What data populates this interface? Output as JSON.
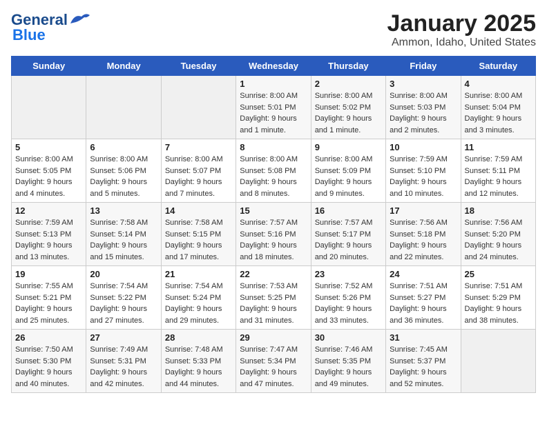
{
  "logo": {
    "line1": "General",
    "line2": "Blue"
  },
  "title": "January 2025",
  "subtitle": "Ammon, Idaho, United States",
  "days_of_week": [
    "Sunday",
    "Monday",
    "Tuesday",
    "Wednesday",
    "Thursday",
    "Friday",
    "Saturday"
  ],
  "weeks": [
    [
      {
        "day": "",
        "info": ""
      },
      {
        "day": "",
        "info": ""
      },
      {
        "day": "",
        "info": ""
      },
      {
        "day": "1",
        "info": "Sunrise: 8:00 AM\nSunset: 5:01 PM\nDaylight: 9 hours\nand 1 minute."
      },
      {
        "day": "2",
        "info": "Sunrise: 8:00 AM\nSunset: 5:02 PM\nDaylight: 9 hours\nand 1 minute."
      },
      {
        "day": "3",
        "info": "Sunrise: 8:00 AM\nSunset: 5:03 PM\nDaylight: 9 hours\nand 2 minutes."
      },
      {
        "day": "4",
        "info": "Sunrise: 8:00 AM\nSunset: 5:04 PM\nDaylight: 9 hours\nand 3 minutes."
      }
    ],
    [
      {
        "day": "5",
        "info": "Sunrise: 8:00 AM\nSunset: 5:05 PM\nDaylight: 9 hours\nand 4 minutes."
      },
      {
        "day": "6",
        "info": "Sunrise: 8:00 AM\nSunset: 5:06 PM\nDaylight: 9 hours\nand 5 minutes."
      },
      {
        "day": "7",
        "info": "Sunrise: 8:00 AM\nSunset: 5:07 PM\nDaylight: 9 hours\nand 7 minutes."
      },
      {
        "day": "8",
        "info": "Sunrise: 8:00 AM\nSunset: 5:08 PM\nDaylight: 9 hours\nand 8 minutes."
      },
      {
        "day": "9",
        "info": "Sunrise: 8:00 AM\nSunset: 5:09 PM\nDaylight: 9 hours\nand 9 minutes."
      },
      {
        "day": "10",
        "info": "Sunrise: 7:59 AM\nSunset: 5:10 PM\nDaylight: 9 hours\nand 10 minutes."
      },
      {
        "day": "11",
        "info": "Sunrise: 7:59 AM\nSunset: 5:11 PM\nDaylight: 9 hours\nand 12 minutes."
      }
    ],
    [
      {
        "day": "12",
        "info": "Sunrise: 7:59 AM\nSunset: 5:13 PM\nDaylight: 9 hours\nand 13 minutes."
      },
      {
        "day": "13",
        "info": "Sunrise: 7:58 AM\nSunset: 5:14 PM\nDaylight: 9 hours\nand 15 minutes."
      },
      {
        "day": "14",
        "info": "Sunrise: 7:58 AM\nSunset: 5:15 PM\nDaylight: 9 hours\nand 17 minutes."
      },
      {
        "day": "15",
        "info": "Sunrise: 7:57 AM\nSunset: 5:16 PM\nDaylight: 9 hours\nand 18 minutes."
      },
      {
        "day": "16",
        "info": "Sunrise: 7:57 AM\nSunset: 5:17 PM\nDaylight: 9 hours\nand 20 minutes."
      },
      {
        "day": "17",
        "info": "Sunrise: 7:56 AM\nSunset: 5:18 PM\nDaylight: 9 hours\nand 22 minutes."
      },
      {
        "day": "18",
        "info": "Sunrise: 7:56 AM\nSunset: 5:20 PM\nDaylight: 9 hours\nand 24 minutes."
      }
    ],
    [
      {
        "day": "19",
        "info": "Sunrise: 7:55 AM\nSunset: 5:21 PM\nDaylight: 9 hours\nand 25 minutes."
      },
      {
        "day": "20",
        "info": "Sunrise: 7:54 AM\nSunset: 5:22 PM\nDaylight: 9 hours\nand 27 minutes."
      },
      {
        "day": "21",
        "info": "Sunrise: 7:54 AM\nSunset: 5:24 PM\nDaylight: 9 hours\nand 29 minutes."
      },
      {
        "day": "22",
        "info": "Sunrise: 7:53 AM\nSunset: 5:25 PM\nDaylight: 9 hours\nand 31 minutes."
      },
      {
        "day": "23",
        "info": "Sunrise: 7:52 AM\nSunset: 5:26 PM\nDaylight: 9 hours\nand 33 minutes."
      },
      {
        "day": "24",
        "info": "Sunrise: 7:51 AM\nSunset: 5:27 PM\nDaylight: 9 hours\nand 36 minutes."
      },
      {
        "day": "25",
        "info": "Sunrise: 7:51 AM\nSunset: 5:29 PM\nDaylight: 9 hours\nand 38 minutes."
      }
    ],
    [
      {
        "day": "26",
        "info": "Sunrise: 7:50 AM\nSunset: 5:30 PM\nDaylight: 9 hours\nand 40 minutes."
      },
      {
        "day": "27",
        "info": "Sunrise: 7:49 AM\nSunset: 5:31 PM\nDaylight: 9 hours\nand 42 minutes."
      },
      {
        "day": "28",
        "info": "Sunrise: 7:48 AM\nSunset: 5:33 PM\nDaylight: 9 hours\nand 44 minutes."
      },
      {
        "day": "29",
        "info": "Sunrise: 7:47 AM\nSunset: 5:34 PM\nDaylight: 9 hours\nand 47 minutes."
      },
      {
        "day": "30",
        "info": "Sunrise: 7:46 AM\nSunset: 5:35 PM\nDaylight: 9 hours\nand 49 minutes."
      },
      {
        "day": "31",
        "info": "Sunrise: 7:45 AM\nSunset: 5:37 PM\nDaylight: 9 hours\nand 52 minutes."
      },
      {
        "day": "",
        "info": ""
      }
    ]
  ]
}
